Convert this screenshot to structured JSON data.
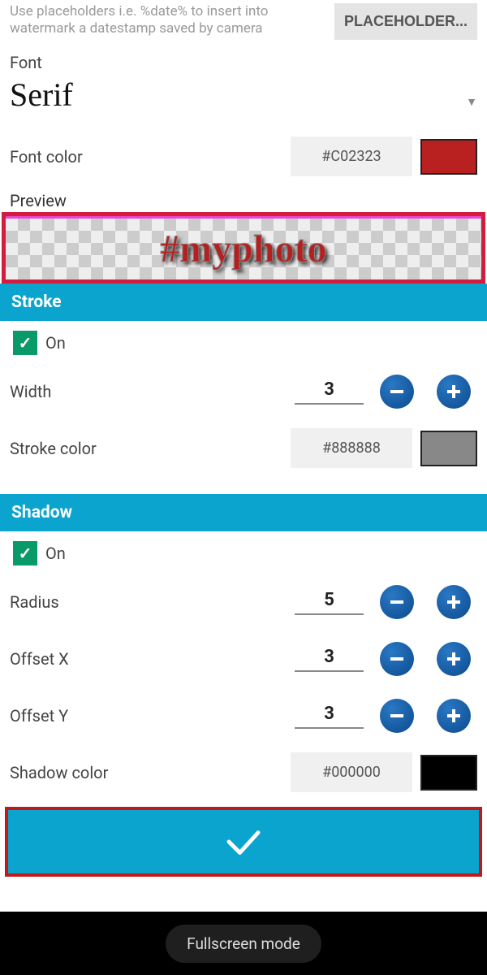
{
  "hint": "Use placeholders i.e. %date% to insert into watermark a datestamp saved by camera",
  "placeholder_btn": "PLACEHOLDER...",
  "font": {
    "label": "Font",
    "value": "Serif"
  },
  "font_color": {
    "label": "Font color",
    "hex": "#C02323",
    "swatch": "#b92020"
  },
  "preview": {
    "label": "Preview",
    "text": "#myphoto"
  },
  "stroke": {
    "header": "Stroke",
    "on_label": "On",
    "width_label": "Width",
    "width_value": "3",
    "color_label": "Stroke color",
    "color_hex": "#888888",
    "color_swatch": "#888888"
  },
  "shadow": {
    "header": "Shadow",
    "on_label": "On",
    "radius_label": "Radius",
    "radius_value": "5",
    "offx_label": "Offset X",
    "offx_value": "3",
    "offy_label": "Offset Y",
    "offy_value": "3",
    "color_label": "Shadow color",
    "color_hex": "#000000",
    "color_swatch": "#000000"
  },
  "bottom": {
    "pill": "Fullscreen mode"
  }
}
